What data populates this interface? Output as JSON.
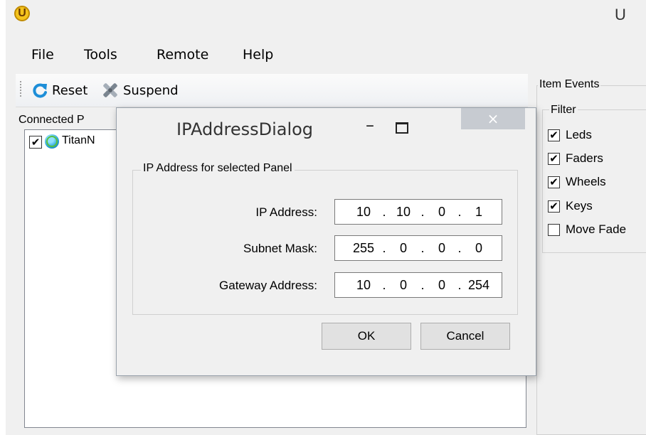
{
  "window": {
    "title_fragment": "U"
  },
  "menu": {
    "items": [
      "File",
      "Tools",
      "Remote",
      "Help"
    ]
  },
  "toolbar": {
    "reset_label": "Reset",
    "suspend_label": "Suspend"
  },
  "panels": {
    "legend": "Connected P",
    "items": [
      {
        "label": "TitanN",
        "checked": true
      }
    ]
  },
  "item_events": {
    "legend": "Item Events",
    "filter_legend": "Filter",
    "filters": [
      {
        "label": "Leds",
        "checked": true
      },
      {
        "label": "Faders",
        "checked": true
      },
      {
        "label": "Wheels",
        "checked": true
      },
      {
        "label": "Keys",
        "checked": true
      },
      {
        "label": "Move Fade",
        "checked": false
      }
    ]
  },
  "dialog": {
    "title": "IPAddressDialog",
    "group_label": "IP Address for selected Panel",
    "fields": [
      {
        "label": "IP Address:",
        "octets": [
          "10",
          "10",
          "0",
          "1"
        ]
      },
      {
        "label": "Subnet Mask:",
        "octets": [
          "255",
          "0",
          "0",
          "0"
        ]
      },
      {
        "label": "Gateway Address:",
        "octets": [
          "10",
          "0",
          "0",
          "254"
        ]
      }
    ],
    "ok_label": "OK",
    "cancel_label": "Cancel",
    "close_glyph": "×",
    "minimize_glyph": "–"
  },
  "colors": {
    "close_button_bg": "#c7cbd1",
    "logo_yellow": "#f4c31c",
    "reset_icon_blue": "#1d8ed8"
  }
}
